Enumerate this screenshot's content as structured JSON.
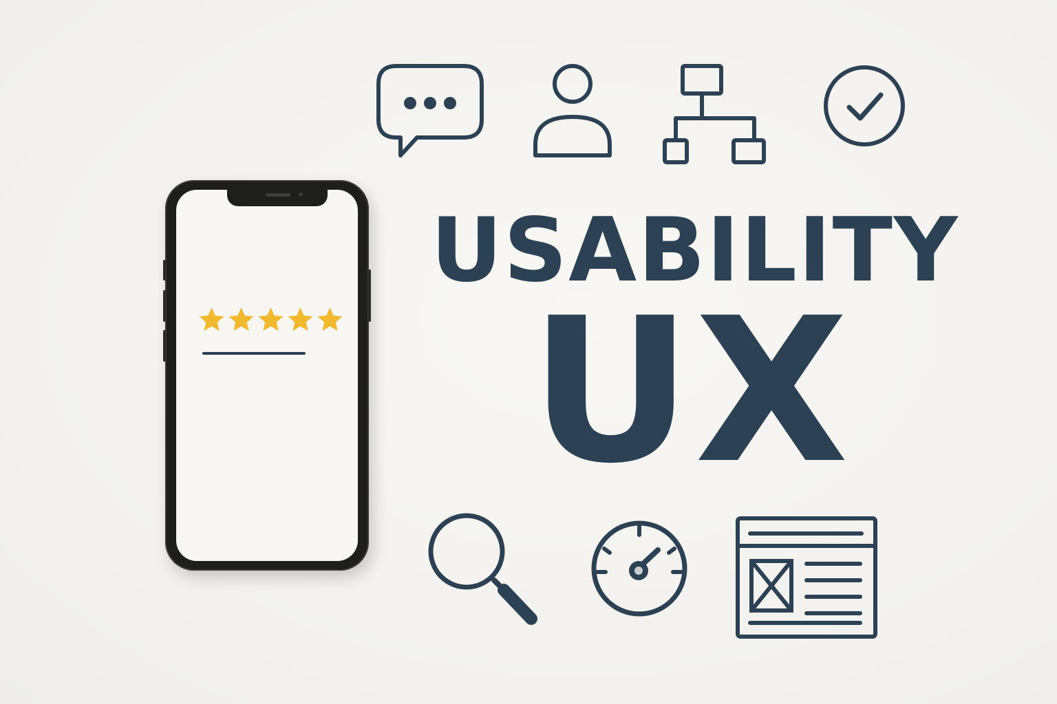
{
  "colors": {
    "ink": "#2c4254",
    "star": "#f2b92e",
    "background": "#f4f3f0",
    "phone_body": "#1e1e1c"
  },
  "headline": {
    "line1": "USABILITY",
    "line2": "UX"
  },
  "icons": [
    "chat-bubble-icon",
    "user-icon",
    "sitemap-icon",
    "check-circle-icon",
    "search-icon",
    "speedometer-icon",
    "wireframe-layout-icon"
  ],
  "phone": {
    "rating": {
      "stars_filled": 5,
      "stars_total": 5
    }
  }
}
